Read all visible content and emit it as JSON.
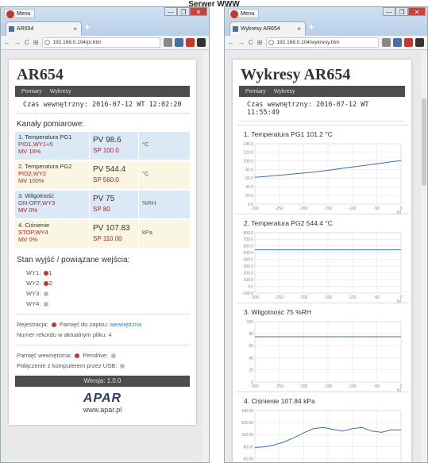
{
  "page_title": "Serwer WWW",
  "window_controls": [
    "—",
    "❐",
    "✕"
  ],
  "left": {
    "menu_label": "Menu",
    "tab_title": "AR654",
    "tab_close": "×",
    "new_tab": "+",
    "nav": [
      "←",
      "→",
      "C",
      "⊞"
    ],
    "url": "192.168.0.104/pl.htm",
    "title": "AR654",
    "menu_items": [
      "Pomiary",
      "Wykresy"
    ],
    "clock": "Czas wewnętrzny: 2016-07-12 WT 12:02:20",
    "channels_heading": "Kanały pomiarowe:",
    "channels": [
      {
        "name": "1. Temperatura PG1",
        "status1": "PID1,WY1+5",
        "status2": "MV 16%",
        "pv": "PV 98.6",
        "sp": "SP 100.0",
        "unit": "°C"
      },
      {
        "name": "2. Temperatura PG2",
        "status1": "PID2,WY2",
        "status2": "MV 100%",
        "pv": "PV 544.4",
        "sp": "SP 560.0",
        "unit": "°C"
      },
      {
        "name": "3. Wilgotność",
        "status1": "ON-OFF,WY3",
        "status2": "MV 0%",
        "pv": "PV 75",
        "sp": "SP 80",
        "unit": "%RH"
      },
      {
        "name": "4. Ciśnienie",
        "status1": "STOP,WY4",
        "status2": "MV 0%",
        "pv": "PV 107.83",
        "sp": "SP 110.00",
        "unit": "kPa"
      }
    ],
    "outputs_heading": "Stan wyjść / powiązane wejścia:",
    "outputs": [
      {
        "label": "WY1:",
        "num": "1"
      },
      {
        "label": "WY2:",
        "num": "2"
      },
      {
        "label": "WY3:",
        "num": ""
      },
      {
        "label": "WY4:",
        "num": ""
      }
    ],
    "registration_label": "Rejestracja:",
    "memory_label": "Pamięć do zapisu:",
    "memory_value": "wewnętrzna",
    "record_label": "Numer rekordu w aktualnym pliku:",
    "record_value": "4",
    "internal_mem_label": "Pamięć wewnętrzna:",
    "pendrive_label": "Pendrive:",
    "usb_label": "Połączenie z komputerem przez USB:",
    "version": "Wersja: 1.0.0",
    "brand": "APAR",
    "brand_url": "www.apar.pl"
  },
  "right": {
    "menu_label": "Menu",
    "tab_title": "Wykresy AR654",
    "tab_close": "×",
    "new_tab": "+",
    "nav": [
      "←",
      "→",
      "C",
      "⊞"
    ],
    "url": "192.168.0.104/wykresy.htm",
    "title": "Wykresy AR654",
    "menu_items": [
      "Pomiary",
      "Wykresy"
    ],
    "clock": "Czas wewnętrzny: 2016-07-12 WT 11:55:49",
    "chart_titles": [
      "1. Temperatura PG1   101.2 °C",
      "2. Temperatura PG2   544.4 °C",
      "3. Wilgotność   75 %RH",
      "4. Ciśnienie   107.84 kPa"
    ]
  },
  "colors": {
    "accent": "#3a6fb7",
    "dark_bar": "#4d4d4d",
    "status_red": "#b22222"
  },
  "chart_data": [
    {
      "type": "line",
      "title": "1. Temperatura PG1   101.2 °C",
      "xlabel": "[s]",
      "x": [
        -300,
        -280,
        -260,
        -240,
        -220,
        -200,
        -180,
        -160,
        -140,
        -120,
        -100,
        -80,
        -60,
        -40,
        -20,
        0
      ],
      "y": [
        62,
        64,
        66,
        68,
        70,
        72,
        74,
        77,
        80,
        83,
        86,
        89,
        92,
        95,
        98,
        101
      ],
      "xlim": [
        -300,
        0
      ],
      "ylim": [
        0,
        140
      ],
      "yticks": [
        "0.0",
        "20.0",
        "40.0",
        "60.0",
        "80.0",
        "100.0",
        "120.0",
        "140.0"
      ],
      "xticks": [
        "-300",
        "-250",
        "-200",
        "-150",
        "-100",
        "-50",
        "0"
      ],
      "grid": true
    },
    {
      "type": "line",
      "title": "2. Temperatura PG2   544.4 °C",
      "xlabel": "[s]",
      "x": [
        -300,
        0
      ],
      "y": [
        544.4,
        544.4
      ],
      "xlim": [
        -300,
        0
      ],
      "ylim": [
        -100,
        800
      ],
      "yticks": [
        "-100.0",
        "0.0",
        "100.0",
        "200.0",
        "300.0",
        "400.0",
        "500.0",
        "600.0",
        "700.0",
        "800.0"
      ],
      "xticks": [
        "-300",
        "-250",
        "-200",
        "-150",
        "-100",
        "-50",
        "0"
      ],
      "grid": true
    },
    {
      "type": "line",
      "title": "3. Wilgotność   75 %RH",
      "xlabel": "[s]",
      "x": [
        -300,
        0
      ],
      "y": [
        75,
        75
      ],
      "xlim": [
        -300,
        0
      ],
      "ylim": [
        0,
        100
      ],
      "yticks": [
        "0",
        "20",
        "40",
        "60",
        "80",
        "100"
      ],
      "xticks": [
        "-300",
        "-250",
        "-200",
        "-150",
        "-100",
        "-50",
        "0"
      ],
      "grid": true
    },
    {
      "type": "line",
      "title": "4. Ciśnienie   107.84 kPa",
      "x": [
        -300,
        -280,
        -260,
        -240,
        -220,
        -200,
        -180,
        -160,
        -140,
        -120,
        -100,
        -80,
        -60,
        -40,
        -20,
        0
      ],
      "y": [
        79,
        80,
        83,
        88,
        95,
        103,
        110,
        112,
        109,
        106,
        110,
        112,
        106,
        104,
        108,
        107.84
      ],
      "xlim": [
        -300,
        0
      ],
      "ylim": [
        40,
        140
      ],
      "yticks": [
        "40.00",
        "60.00",
        "80.00",
        "100.00",
        "120.00",
        "140.00"
      ],
      "grid": true
    }
  ]
}
